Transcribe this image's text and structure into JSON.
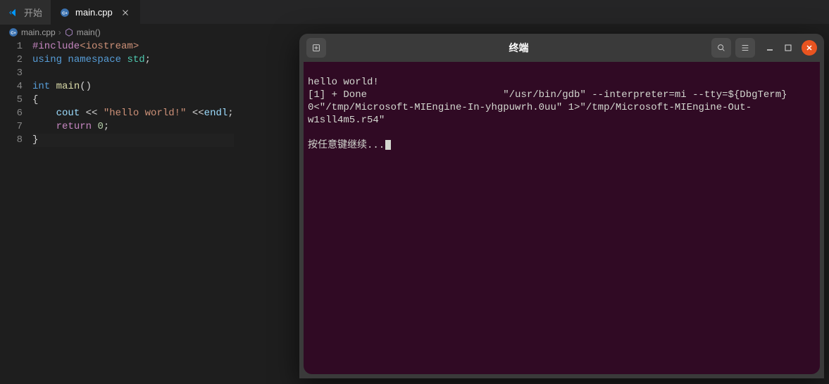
{
  "tabs": [
    {
      "label": "开始",
      "icon": "vscode-icon",
      "active": false
    },
    {
      "label": "main.cpp",
      "icon": "cpp-icon",
      "active": true
    }
  ],
  "breadcrumbs": {
    "file_icon": "cpp-icon",
    "file": "main.cpp",
    "sep": "›",
    "symbol_icon": "cube-icon",
    "symbol": "main()"
  },
  "code": {
    "lines": {
      "1": {
        "include_kw": "#include",
        "header": "<iostream>"
      },
      "2": {
        "using": "using",
        "namespace": "namespace",
        "ns": "std",
        "semi": ";"
      },
      "3": "",
      "4": {
        "type": "int",
        "func": "main",
        "parens": "()"
      },
      "5": "{",
      "6": {
        "indent": "    ",
        "cout": "cout",
        "op1": " << ",
        "str": "\"hello world!\"",
        "op2": " <<",
        "endl": "endl",
        "semi": ";"
      },
      "7": {
        "indent": "    ",
        "return": "return",
        "val": "0",
        "semi": ";"
      },
      "8": "}"
    },
    "line_numbers": [
      "1",
      "2",
      "3",
      "4",
      "5",
      "6",
      "7",
      "8"
    ]
  },
  "terminal": {
    "title": "终端",
    "output": {
      "l1": "hello world!",
      "l2": "[1] + Done                       \"/usr/bin/gdb\" --interpreter=mi --tty=${DbgTerm} 0<\"/tmp/Microsoft-MIEngine-In-yhgpuwrh.0uu\" 1>\"/tmp/Microsoft-MIEngine-Out-w1sll4m5.r54\"",
      "prompt": "按任意键继续..."
    }
  }
}
